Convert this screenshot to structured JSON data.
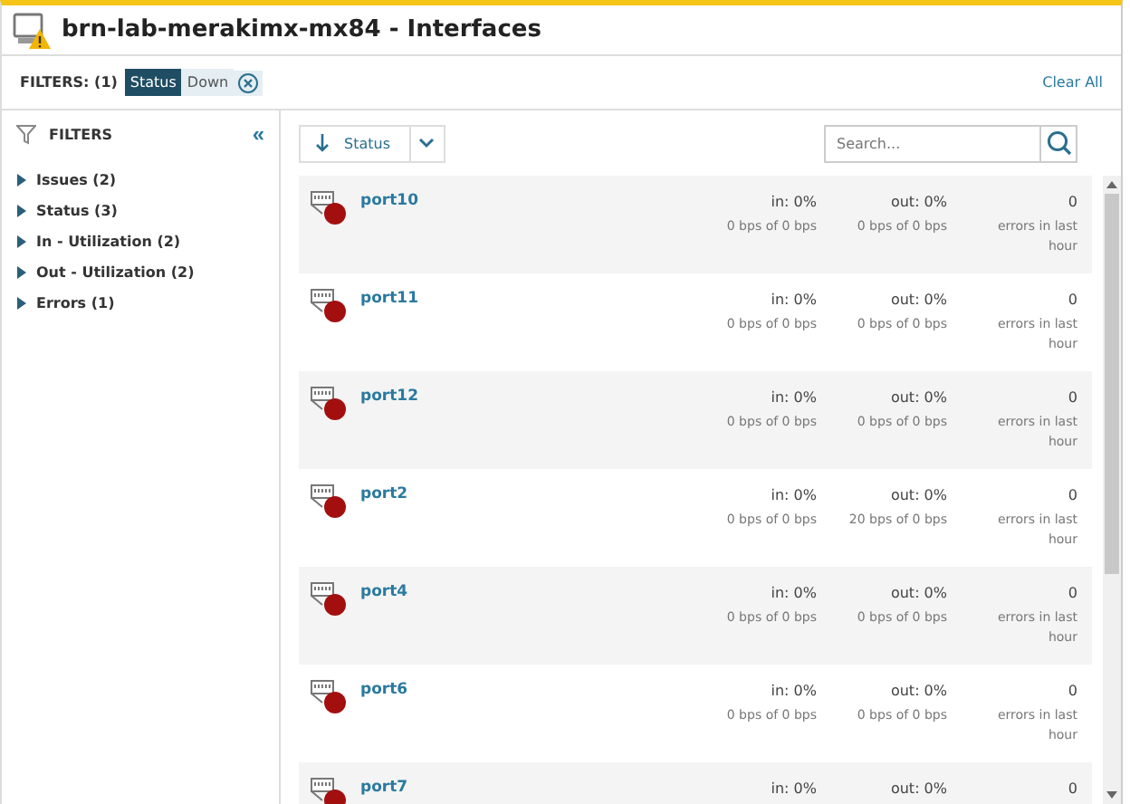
{
  "window": {
    "title": "brn-lab-merakimx-mx84 - Interfaces"
  },
  "filter_bar": {
    "label": "FILTERS: (1)",
    "chips": [
      {
        "key": "Status",
        "value": "Down"
      }
    ],
    "clear_all": "Clear All"
  },
  "sidebar": {
    "title": "FILTERS",
    "collapse": "«",
    "items": [
      {
        "label": "Issues (2)",
        "expanded": false
      },
      {
        "label": "Status (3)",
        "expanded": false
      },
      {
        "label": "In - Utilization (2)",
        "expanded": false
      },
      {
        "label": "Out - Utilization (2)",
        "expanded": false
      },
      {
        "label": "Errors (1)",
        "expanded": false
      }
    ]
  },
  "toolbar": {
    "sort_label": "Status",
    "search_placeholder": "Search..."
  },
  "interfaces": [
    {
      "name": "port10",
      "color": "#a30f0f",
      "in": "in: 0%",
      "in_rate": "0 bps of 0 bps",
      "out": "out: 0%",
      "out_rate": "0 bps of 0 bps",
      "errors": "0",
      "errors_label": "errors in last hour"
    },
    {
      "name": "port11",
      "color": "#a30f0f",
      "in": "in: 0%",
      "in_rate": "0 bps of 0 bps",
      "out": "out: 0%",
      "out_rate": "0 bps of 0 bps",
      "errors": "0",
      "errors_label": "errors in last hour"
    },
    {
      "name": "port12",
      "color": "#a30f0f",
      "in": "in: 0%",
      "in_rate": "0 bps of 0 bps",
      "out": "out: 0%",
      "out_rate": "0 bps of 0 bps",
      "errors": "0",
      "errors_label": "errors in last hour"
    },
    {
      "name": "port2",
      "color": "#a30f0f",
      "in": "in: 0%",
      "in_rate": "0 bps of 0 bps",
      "out": "out: 0%",
      "out_rate": "20 bps of 0 bps",
      "errors": "0",
      "errors_label": "errors in last hour"
    },
    {
      "name": "port4",
      "color": "#a30f0f",
      "in": "in: 0%",
      "in_rate": "0 bps of 0 bps",
      "out": "out: 0%",
      "out_rate": "0 bps of 0 bps",
      "errors": "0",
      "errors_label": "errors in last hour"
    },
    {
      "name": "port6",
      "color": "#a30f0f",
      "in": "in: 0%",
      "in_rate": "0 bps of 0 bps",
      "out": "out: 0%",
      "out_rate": "0 bps of 0 bps",
      "errors": "0",
      "errors_label": "errors in last hour"
    },
    {
      "name": "port7",
      "color": "#a30f0f",
      "in": "in: 0%",
      "out": "out: 0%",
      "errors": "0"
    }
  ]
}
